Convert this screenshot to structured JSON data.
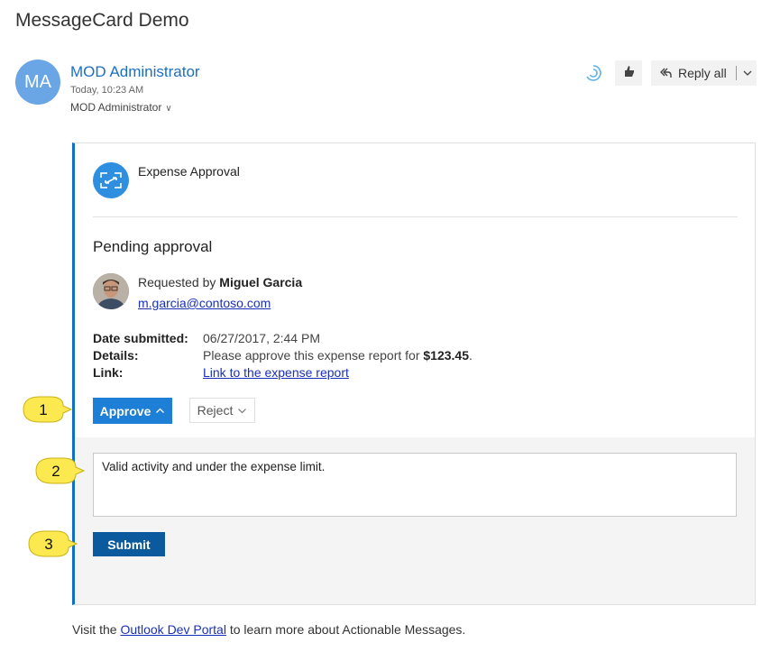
{
  "email": {
    "subject": "MessageCard Demo",
    "avatar_initials": "MA",
    "sender": "MOD Administrator",
    "sent_time": "Today, 10:23 AM",
    "recipient": "MOD Administrator"
  },
  "toolbar": {
    "reply_all_label": "Reply all"
  },
  "card": {
    "title": "Expense Approval",
    "heading": "Pending approval",
    "requested_prefix": "Requested by ",
    "requester_name": "Miguel Garcia",
    "requester_email": "m.garcia@contoso.com",
    "facts": [
      {
        "label": "Date submitted:",
        "value": "06/27/2017, 2:44 PM"
      },
      {
        "label": "Details:",
        "value_prefix": "Please approve this expense report for ",
        "value_bold": "$123.45",
        "value_suffix": "."
      },
      {
        "label": "Link:",
        "value": "Link to the expense report"
      }
    ],
    "actions": {
      "approve_label": "Approve",
      "reject_label": "Reject"
    },
    "comment_value": "Valid activity and under the expense limit.",
    "submit_label": "Submit"
  },
  "callouts": [
    "1",
    "2",
    "3"
  ],
  "footer": {
    "prefix": "Visit the ",
    "link": "Outlook Dev Portal",
    "suffix": " to learn more about Actionable Messages."
  },
  "colors": {
    "accent": "#0f6fc6",
    "approve_button": "#1e7fd6",
    "submit_button": "#0b5a9e",
    "link": "#1a2fb8",
    "callout_fill": "#fbe94f"
  },
  "icons": [
    "loading-icon",
    "like-icon",
    "reply-all-icon",
    "chevron-down-icon",
    "expand-arrows-icon",
    "chevron-up-icon"
  ]
}
